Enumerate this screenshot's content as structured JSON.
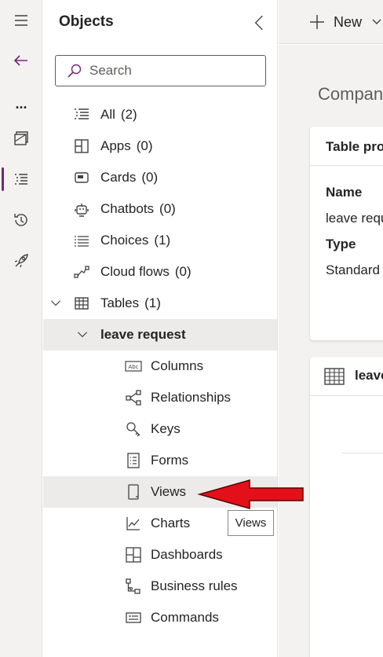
{
  "rail": {
    "items": [
      {
        "name": "hamburger-menu"
      },
      {
        "name": "back"
      },
      {
        "name": "more"
      },
      {
        "name": "pages"
      },
      {
        "name": "objects"
      },
      {
        "name": "history"
      },
      {
        "name": "publish"
      }
    ],
    "more_label": "..."
  },
  "objects_panel": {
    "title": "Objects",
    "search_placeholder": "Search",
    "items": [
      {
        "label": "All",
        "count": "(2)"
      },
      {
        "label": "Apps",
        "count": "(0)"
      },
      {
        "label": "Cards",
        "count": "(0)"
      },
      {
        "label": "Chatbots",
        "count": "(0)"
      },
      {
        "label": "Choices",
        "count": "(1)"
      },
      {
        "label": "Cloud flows",
        "count": "(0)"
      },
      {
        "label": "Tables",
        "count": "(1)"
      }
    ],
    "table_name": "leave request",
    "table_children": [
      {
        "label": "Columns"
      },
      {
        "label": "Relationships"
      },
      {
        "label": "Keys"
      },
      {
        "label": "Forms"
      },
      {
        "label": "Views"
      },
      {
        "label": "Charts"
      },
      {
        "label": "Dashboards"
      },
      {
        "label": "Business rules"
      },
      {
        "label": "Commands"
      }
    ],
    "tooltip": "Views"
  },
  "toolbar": {
    "new_label": "New"
  },
  "main": {
    "breadcrumb": "Compan",
    "properties_card": {
      "title": "Table pro",
      "name_label": "Name",
      "name_value": "leave requ",
      "type_label": "Type",
      "type_value": "Standard"
    },
    "table_card": {
      "title": "leave"
    }
  },
  "colors": {
    "accent": "#742774",
    "rail_bg": "#f3f2f1",
    "highlight": "#edebe9",
    "arrow": "#e3101a"
  }
}
